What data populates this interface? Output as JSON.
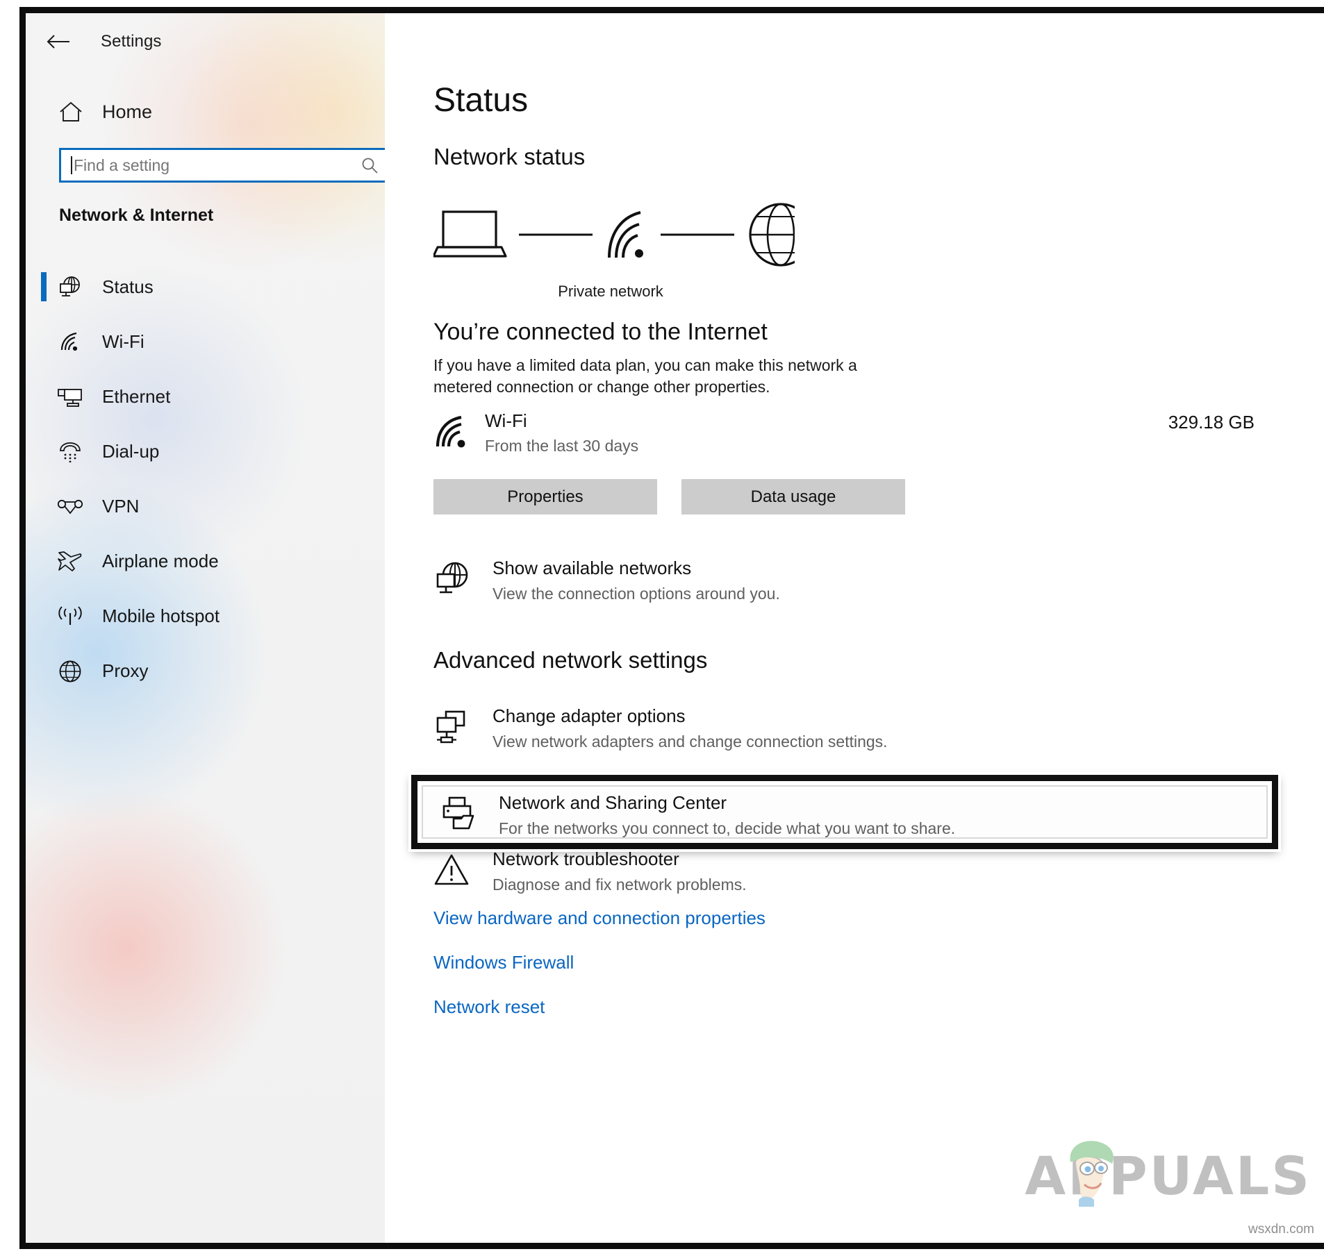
{
  "window": {
    "app_title": "Settings",
    "back_label": "Back"
  },
  "sidebar": {
    "home_label": "Home",
    "search": {
      "value": "",
      "placeholder": "Find a setting"
    },
    "category_heading": "Network & Internet",
    "items": [
      {
        "label": "Status",
        "icon": "globe-monitor-icon",
        "selected": true
      },
      {
        "label": "Wi-Fi",
        "icon": "wifi-icon",
        "selected": false
      },
      {
        "label": "Ethernet",
        "icon": "ethernet-icon",
        "selected": false
      },
      {
        "label": "Dial-up",
        "icon": "dialup-phone-icon",
        "selected": false
      },
      {
        "label": "VPN",
        "icon": "vpn-icon",
        "selected": false
      },
      {
        "label": "Airplane mode",
        "icon": "airplane-icon",
        "selected": false
      },
      {
        "label": "Mobile hotspot",
        "icon": "hotspot-icon",
        "selected": false
      },
      {
        "label": "Proxy",
        "icon": "globe-icon",
        "selected": false
      }
    ]
  },
  "main": {
    "page_title": "Status",
    "network_status_heading": "Network status",
    "diagram": {
      "device_icon": "laptop-icon",
      "link_icon": "wifi-signal-icon",
      "internet_icon": "globe-icon",
      "caption": "Private network"
    },
    "connected_heading": "You’re connected to the Internet",
    "connected_description": "If you have a limited data plan, you can make this network a metered connection or change other properties.",
    "connection": {
      "name": "Wi-Fi",
      "subtitle": "From the last 30 days",
      "data_usage": "329.18 GB",
      "icon": "wifi-icon"
    },
    "buttons": {
      "properties": "Properties",
      "data_usage": "Data usage"
    },
    "show_networks": {
      "title": "Show available networks",
      "subtitle": "View the connection options around you.",
      "icon": "globe-monitor-icon"
    },
    "advanced_heading": "Advanced network settings",
    "advanced_items": [
      {
        "title": "Change adapter options",
        "subtitle": "View network adapters and change connection settings.",
        "icon": "adapter-icon",
        "highlighted": false
      },
      {
        "title": "Network and Sharing Center",
        "subtitle": "For the networks you connect to, decide what you want to share.",
        "icon": "sharing-center-icon",
        "highlighted": true
      },
      {
        "title": "Network troubleshooter",
        "subtitle": "Diagnose and fix network problems.",
        "icon": "warning-triangle-icon",
        "highlighted": false
      }
    ],
    "links": [
      "View hardware and connection properties",
      "Windows Firewall",
      "Network reset"
    ]
  },
  "watermark": {
    "brand": "APPUALS",
    "site": "wsxdn.com"
  },
  "colors": {
    "accent": "#0a6cbd",
    "link": "#0a66c2",
    "button_bg": "#cccccc",
    "sidebar_bg": "#f2f2f2",
    "text": "#111111",
    "muted_text": "#5f5f5f",
    "highlight_border": "#101010"
  }
}
